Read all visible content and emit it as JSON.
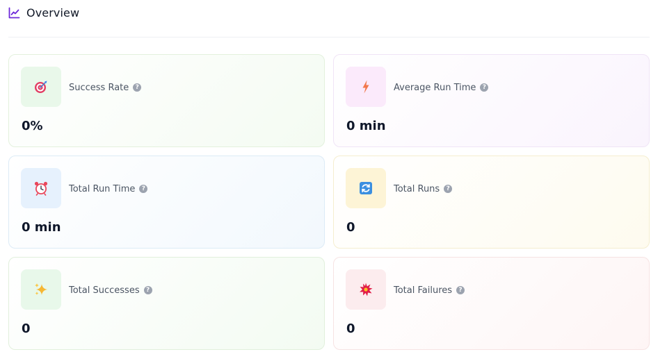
{
  "header": {
    "title": "Overview",
    "icon": "line-chart-icon",
    "accent": "#6d28d9"
  },
  "cards": [
    {
      "label": "Success Rate",
      "value": "0%",
      "icon": "target-icon"
    },
    {
      "label": "Average Run Time",
      "value": "0 min",
      "icon": "lightning-icon"
    },
    {
      "label": "Total Run Time",
      "value": "0 min",
      "icon": "alarm-clock-icon"
    },
    {
      "label": "Total Runs",
      "value": "0",
      "icon": "refresh-icon"
    },
    {
      "label": "Total Successes",
      "value": "0",
      "icon": "sparkles-icon"
    },
    {
      "label": "Total Failures",
      "value": "0",
      "icon": "collision-icon"
    }
  ],
  "help_glyph": "?"
}
